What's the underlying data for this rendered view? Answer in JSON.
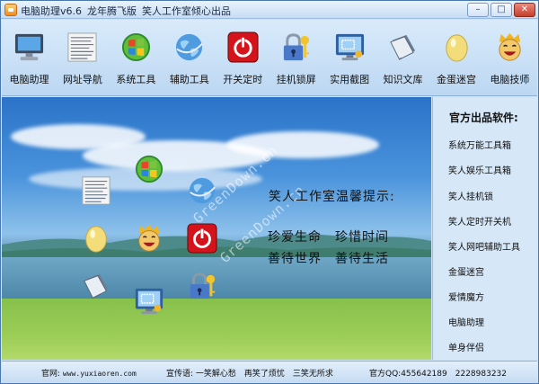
{
  "window": {
    "app_name": "电脑助理v6.6",
    "edition": "龙年腾飞版",
    "studio": "笑人工作室倾心出品",
    "controls": [
      "–",
      "□",
      "✕"
    ]
  },
  "toolbar": [
    {
      "label": "电脑助理",
      "icon": "monitor-icon"
    },
    {
      "label": "网址导航",
      "icon": "web-page-icon"
    },
    {
      "label": "系统工具",
      "icon": "windows-orb-icon"
    },
    {
      "label": "辅助工具",
      "icon": "globe-icon"
    },
    {
      "label": "开关定时",
      "icon": "power-button-icon"
    },
    {
      "label": "挂机锁屏",
      "icon": "padlock-key-icon"
    },
    {
      "label": "实用截图",
      "icon": "screen-capture-icon"
    },
    {
      "label": "知识文库",
      "icon": "book-icon"
    },
    {
      "label": "金蛋迷宫",
      "icon": "golden-egg-icon"
    },
    {
      "label": "电脑技师",
      "icon": "technician-face-icon"
    }
  ],
  "main": {
    "tip_title": "笑人工作室温馨提示:",
    "tip_lines": [
      "珍爱生命　珍惜时间",
      "善待世界　善待生活"
    ],
    "watermark": "GreenDown.cn"
  },
  "side": {
    "title": "官方出品软件:",
    "items": [
      "系统万能工具箱",
      "笑人娱乐工具箱",
      "笑人挂机锁",
      "笑人定时开关机",
      "笑人网吧辅助工具",
      "金蛋迷宫",
      "爱情魔方",
      "电脑助理",
      "单身伴侣"
    ]
  },
  "status": {
    "website_label": "官网:",
    "website": "www.yuxiaoren.com",
    "slogan_label": "宣传语:",
    "slogan": "一笑解心愁　再笑了烦忧　三笑无所求",
    "qq_label": "官方QQ:",
    "qq": "455642189　2228983232"
  },
  "colors": {
    "frame": "#4a78b0",
    "toolbar": "#cfe3f6",
    "power_red": "#d4141a",
    "egg_gold": "#f3dc7a"
  }
}
